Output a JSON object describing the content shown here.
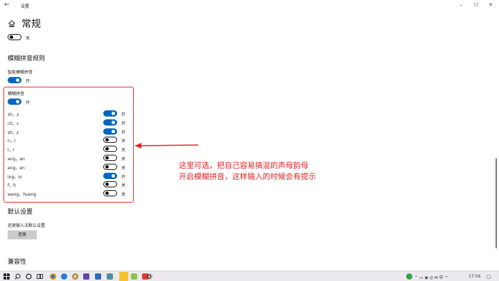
{
  "window": {
    "back_glyph": "←",
    "title": "设置",
    "minimize_glyph": "–",
    "maximize_glyph": "☐",
    "close_glyph": "✕"
  },
  "header": {
    "title": "常规"
  },
  "top_toggle": {
    "state": "关",
    "on": false
  },
  "fuzzy_rules": {
    "heading": "模糊拼音规则",
    "smart": {
      "label": "智能模糊拼音",
      "state": "开",
      "on": true
    },
    "fuzzy": {
      "label": "模糊拼音",
      "state": "开",
      "on": true
    },
    "pairs": [
      {
        "label": "zh，z",
        "state": "开",
        "on": true
      },
      {
        "label": "ch，c",
        "state": "开",
        "on": true
      },
      {
        "label": "sh，s",
        "state": "开",
        "on": true
      },
      {
        "label": "n，l",
        "state": "关",
        "on": false
      },
      {
        "label": "l，r",
        "state": "关",
        "on": false
      },
      {
        "label": "ang，an",
        "state": "关",
        "on": false
      },
      {
        "label": "eng，en",
        "state": "关",
        "on": false
      },
      {
        "label": "ing，in",
        "state": "开",
        "on": true
      },
      {
        "label": "f，h",
        "state": "关",
        "on": false
      },
      {
        "label": "wang，huang",
        "state": "关",
        "on": false
      }
    ]
  },
  "annotation": {
    "line1": "这里可选，把自己容易搞混的声母韵母",
    "line2": "开启模糊拼音，这样输入的时候会有提示",
    "color": "#e02424"
  },
  "defaults": {
    "heading": "默认设置",
    "reset_label": "还原输入法默认设置",
    "reset_button": "还原"
  },
  "compat": {
    "heading": "兼容性"
  },
  "taskbar": {
    "time": "17:56",
    "icons": [
      "start-icon",
      "search-icon",
      "cortana-icon",
      "task-view-icon",
      "chrome-icon",
      "edge-icon",
      "browser-icon",
      "app-icon",
      "media-icon",
      "notes-icon",
      "file-explorer-icon",
      "app-icon-2",
      "app-icon-3",
      "settings-icon"
    ],
    "tray_glyphs": "⌃  ▭  ◉  ◎  ✉  中  ⌔",
    "notification_glyph": "▢"
  },
  "colors": {
    "accent": "#0067c0",
    "red": "#e03030"
  }
}
